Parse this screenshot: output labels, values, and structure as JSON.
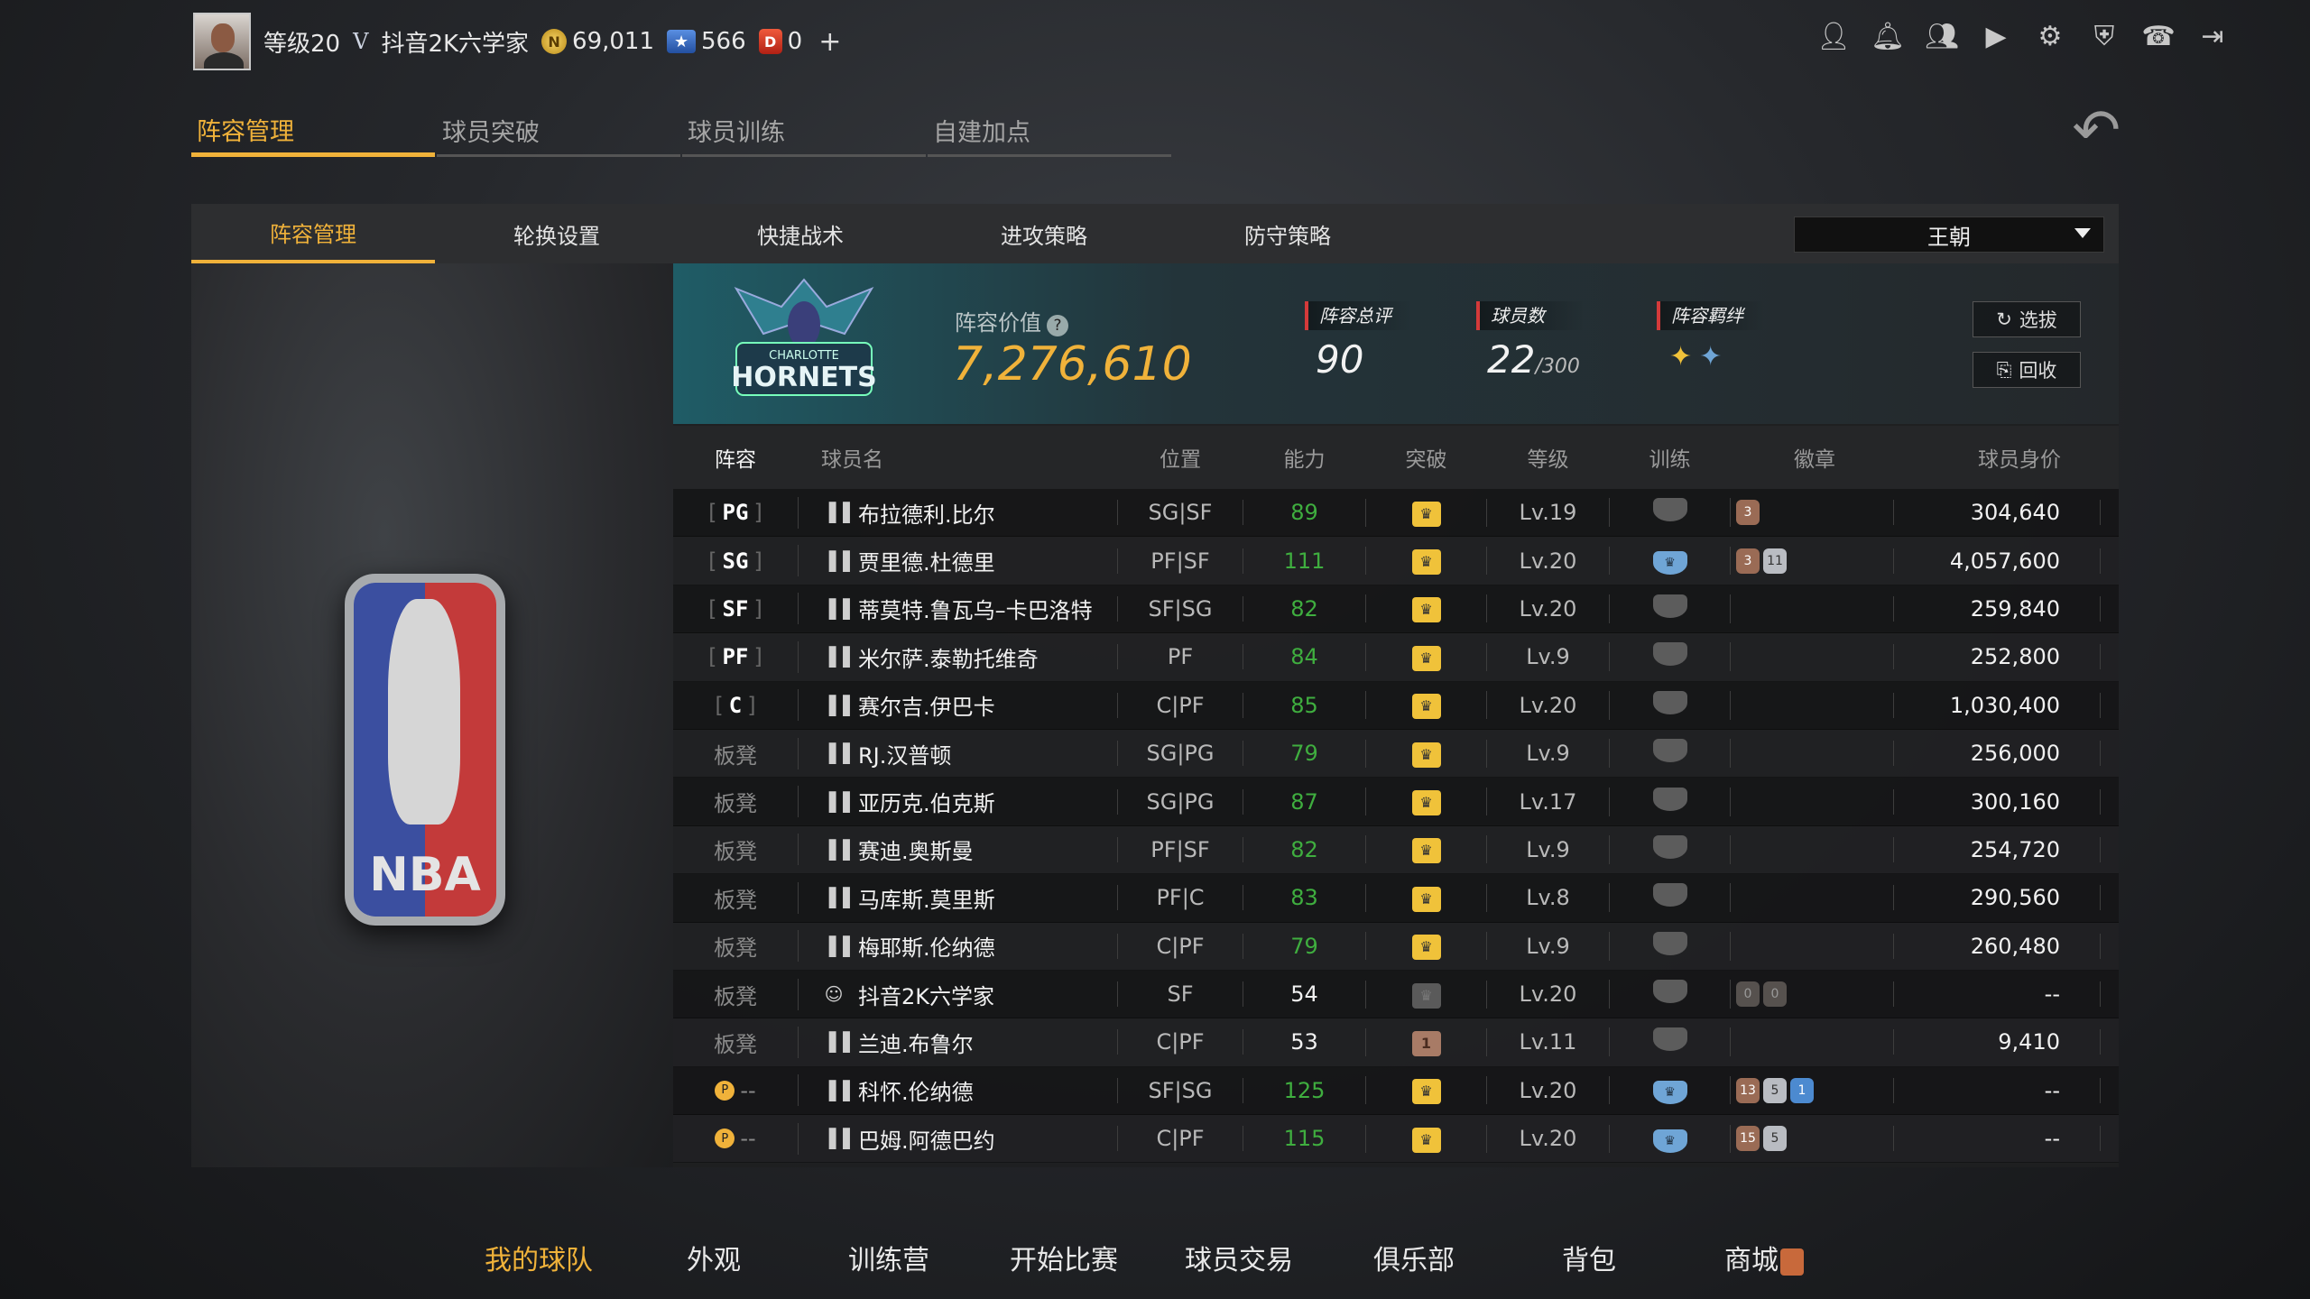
{
  "topbar": {
    "level": "等级20",
    "rank_badge": "V",
    "username": "抖音2K六学家",
    "coins": "69,011",
    "stars": "566",
    "d_points": "0",
    "plus": "+"
  },
  "main_tabs": [
    "阵容管理",
    "球员突破",
    "球员训练",
    "自建加点"
  ],
  "sub_tabs": [
    "阵容管理",
    "轮换设置",
    "快捷战术",
    "进攻策略",
    "防守策略"
  ],
  "dynasty_select": "王朝",
  "team": {
    "value_label": "阵容价值",
    "value": "7,276,610",
    "overall_label": "阵容总评",
    "overall": "90",
    "count_label": "球员数",
    "count": "22",
    "count_max": "/300",
    "bond_label": "阵容羁绊",
    "draft_btn": "选拔",
    "recycle_btn": "回收",
    "logo_top": "CHARLOTTE",
    "logo_main": "HORNETS"
  },
  "table": {
    "headers": {
      "lineup": "阵容",
      "name": "球员名",
      "pos": "位置",
      "ability": "能力",
      "breakthrough": "突破",
      "level": "等级",
      "training": "训练",
      "badges": "徽章",
      "price": "球员身价"
    },
    "rows": [
      {
        "lineup": "PG",
        "name": "布拉德利.比尔",
        "pos": "SG|SF",
        "ability": "89",
        "level": "Lv.19",
        "price": "304,640"
      },
      {
        "lineup": "SG",
        "name": "贾里德.杜德里",
        "pos": "PF|SF",
        "ability": "111",
        "level": "Lv.20",
        "price": "4,057,600"
      },
      {
        "lineup": "SF",
        "name": "蒂莫特.鲁瓦乌–卡巴洛特",
        "pos": "SF|SG",
        "ability": "82",
        "level": "Lv.20",
        "price": "259,840"
      },
      {
        "lineup": "PF",
        "name": "米尔萨.泰勒托维奇",
        "pos": "PF",
        "ability": "84",
        "level": "Lv.9",
        "price": "252,800"
      },
      {
        "lineup": "C",
        "name": "赛尔吉.伊巴卡",
        "pos": "C|PF",
        "ability": "85",
        "level": "Lv.20",
        "price": "1,030,400"
      },
      {
        "lineup": "板凳",
        "name": "RJ.汉普顿",
        "pos": "SG|PG",
        "ability": "79",
        "level": "Lv.9",
        "price": "256,000"
      },
      {
        "lineup": "板凳",
        "name": "亚历克.伯克斯",
        "pos": "SG|PG",
        "ability": "87",
        "level": "Lv.17",
        "price": "300,160"
      },
      {
        "lineup": "板凳",
        "name": "赛迪.奥斯曼",
        "pos": "PF|SF",
        "ability": "82",
        "level": "Lv.9",
        "price": "254,720"
      },
      {
        "lineup": "板凳",
        "name": "马库斯.莫里斯",
        "pos": "PF|C",
        "ability": "83",
        "level": "Lv.8",
        "price": "290,560"
      },
      {
        "lineup": "板凳",
        "name": "梅耶斯.伦纳德",
        "pos": "C|PF",
        "ability": "79",
        "level": "Lv.9",
        "price": "260,480"
      },
      {
        "lineup": "板凳",
        "name": "抖音2K六学家",
        "pos": "SF",
        "ability": "54",
        "level": "Lv.20",
        "price": "--"
      },
      {
        "lineup": "板凳",
        "name": "兰迪.布鲁尔",
        "pos": "C|PF",
        "ability": "53",
        "level": "Lv.11",
        "price": "9,410"
      },
      {
        "lineup": "--",
        "name": "科怀.伦纳德",
        "pos": "SF|SG",
        "ability": "125",
        "level": "Lv.20",
        "price": "--"
      },
      {
        "lineup": "--",
        "name": "巴姆.阿德巴约",
        "pos": "C|PF",
        "ability": "115",
        "level": "Lv.20",
        "price": "--"
      }
    ],
    "row_badges": [
      [
        "3"
      ],
      [
        "3",
        "11"
      ],
      [],
      [],
      [],
      [],
      [],
      [],
      [],
      [],
      [
        "0",
        "0"
      ],
      [],
      [
        "13",
        "5",
        "1"
      ],
      [
        "15",
        "5"
      ]
    ],
    "breakthrough_mark": "1"
  },
  "bottom_nav": [
    "我的球队",
    "外观",
    "训练营",
    "开始比赛",
    "球员交易",
    "俱乐部",
    "背包",
    "商城"
  ],
  "nba_logo": "NBA",
  "colors": {
    "accent": "#f0b23a",
    "ability_green": "#3fae3f",
    "team_teal": "#1f5c66"
  }
}
